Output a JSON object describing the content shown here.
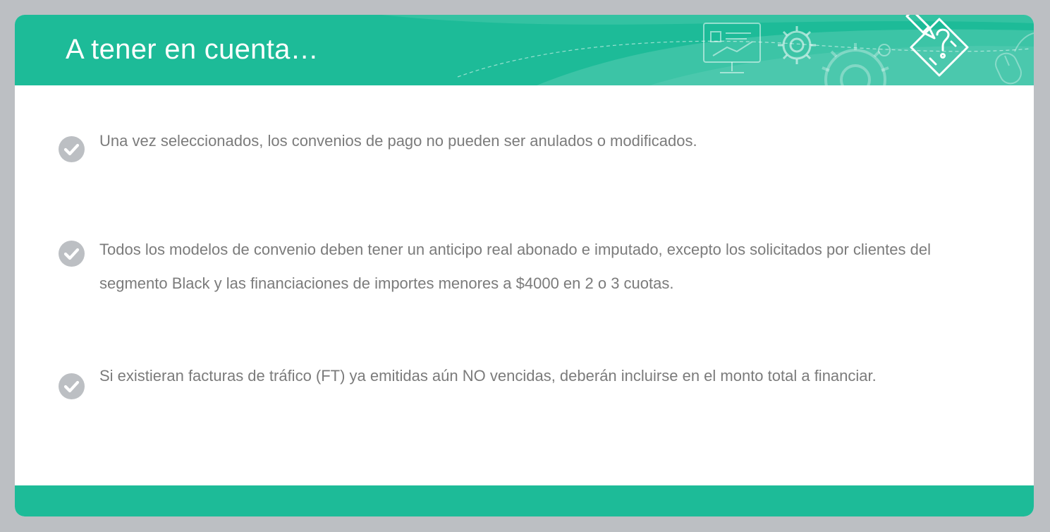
{
  "header": {
    "title": "A tener en cuenta…",
    "decoration_icons": [
      "presentation-board-icon",
      "gear-icon",
      "large-gear-icon",
      "computer-mouse-icon",
      "pencil-question-icon"
    ]
  },
  "bullets": [
    {
      "icon": "check-circle-icon",
      "text": "Una vez seleccionados, los convenios de pago no pueden ser anulados o modificados."
    },
    {
      "icon": "check-circle-icon",
      "text": "Todos los modelos de convenio deben tener un anticipo real abonado e imputado, excepto los solicitados por clientes del segmento Black y las financiaciones de importes menores a $4000 en 2 o 3 cuotas."
    },
    {
      "icon": "check-circle-icon",
      "text": "Si existieran facturas de tráfico (FT) ya emitidas aún NO vencidas, deberán incluirse en el monto total a financiar."
    }
  ],
  "colors": {
    "background": "#bcbfc3",
    "accent": "#1dbb98",
    "body_text": "#7b7b7b",
    "check_circle": "#bcbfc3"
  }
}
